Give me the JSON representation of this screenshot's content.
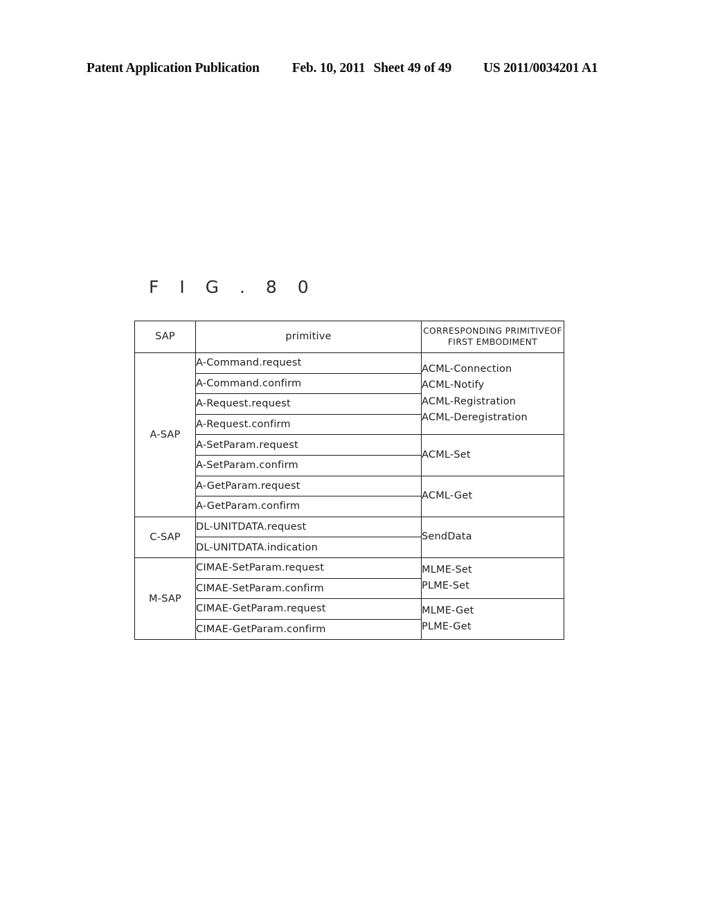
{
  "header": {
    "publication": "Patent Application Publication",
    "date": "Feb. 10, 2011",
    "sheet": "Sheet 49 of 49",
    "document_number": "US 2011/0034201 A1"
  },
  "figure": {
    "label": "F I G . 8 0"
  },
  "table": {
    "columns": [
      {
        "key": "sap",
        "label": "SAP"
      },
      {
        "key": "primitive",
        "label": "primitive"
      },
      {
        "key": "corresponding",
        "label_line1": "CORRESPONDING PRIMITIVE",
        "label_line2": "OF FIRST EMBODIMENT"
      }
    ],
    "groups": [
      {
        "sap": "A-SAP",
        "rows": [
          "A-Command.request",
          "A-Command.confirm",
          "A-Request.request",
          "A-Request.confirm",
          "A-SetParam.request",
          "A-SetParam.confirm",
          "A-GetParam.request",
          "A-GetParam.confirm"
        ],
        "corresponding": [
          {
            "span": 4,
            "lines": [
              "ACML-Connection",
              "ACML-Notify",
              "ACML-Registration",
              "ACML-Deregistration"
            ]
          },
          {
            "span": 2,
            "lines": [
              "ACML-Set"
            ]
          },
          {
            "span": 2,
            "lines": [
              "ACML-Get"
            ]
          }
        ]
      },
      {
        "sap": "C-SAP",
        "rows": [
          "DL-UNITDATA.request",
          "DL-UNITDATA.indication"
        ],
        "corresponding": [
          {
            "span": 2,
            "lines": [
              "SendData"
            ]
          }
        ]
      },
      {
        "sap": "M-SAP",
        "rows": [
          "CIMAE-SetParam.request",
          "CIMAE-SetParam.confirm",
          "CIMAE-GetParam.request",
          "CIMAE-GetParam.confirm"
        ],
        "corresponding": [
          {
            "span": 2,
            "lines": [
              "MLME-Set",
              "PLME-Set"
            ]
          },
          {
            "span": 2,
            "lines": [
              "MLME-Get",
              "PLME-Get"
            ]
          }
        ]
      }
    ]
  }
}
